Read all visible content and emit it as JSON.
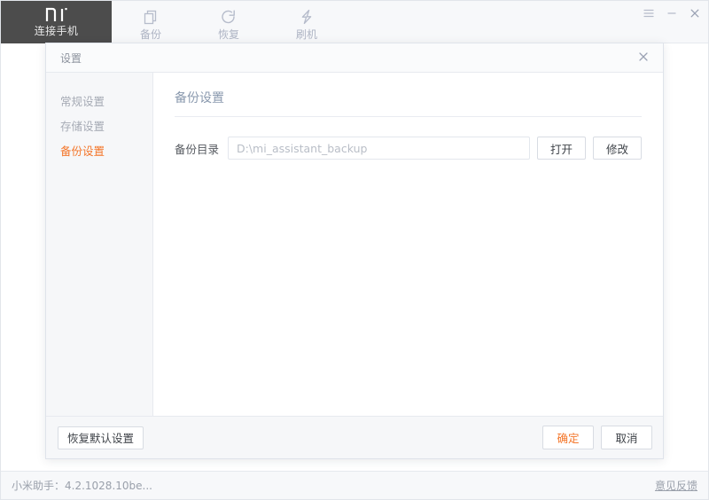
{
  "app": {
    "brand": {
      "logo_icon": "mi-logo-icon",
      "label": "连接手机"
    },
    "nav": [
      {
        "icon": "copy-icon",
        "label": "备份"
      },
      {
        "icon": "restore-circular-arrow-icon",
        "label": "恢复"
      },
      {
        "icon": "lightning-bolt-icon",
        "label": "刷机"
      }
    ],
    "window_controls": [
      {
        "icon": "menu-icon",
        "name": "menu-button"
      },
      {
        "icon": "minimize-icon",
        "name": "minimize-button"
      },
      {
        "icon": "close-icon",
        "name": "close-button"
      }
    ],
    "status_bar": {
      "version_text": "小米助手：4.2.1028.10be...",
      "feedback_label": "意见反馈"
    }
  },
  "dialog": {
    "title": "设置",
    "close_icon": "close-icon",
    "sidebar": [
      {
        "label": "常规设置",
        "active": false
      },
      {
        "label": "存储设置",
        "active": false
      },
      {
        "label": "备份设置",
        "active": true
      }
    ],
    "content": {
      "heading": "备份设置",
      "backup_dir": {
        "label": "备份目录",
        "value": "D:\\mi_assistant_backup",
        "placeholder": "D:\\mi_assistant_backup",
        "open_button": "打开",
        "modify_button": "修改"
      }
    },
    "footer": {
      "restore_defaults": "恢复默认设置",
      "confirm": "确定",
      "cancel": "取消"
    }
  },
  "colors": {
    "accent": "#f4762a",
    "brand_panel": "#4c4c4c",
    "topbar_bg": "#f7f8fa",
    "sidebar_bg": "#f6f7f9",
    "nav_label": "#aeb4c4",
    "heading": "#8a99ae"
  }
}
